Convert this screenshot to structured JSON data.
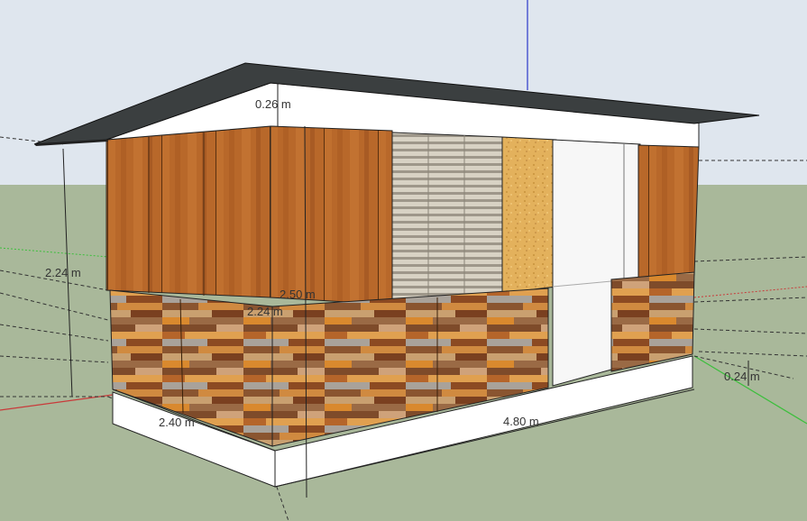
{
  "viewport": {
    "sky_color": "#dfe6ee",
    "ground_color": "#a9b89a",
    "axes": {
      "blue": "#2a37c9",
      "red": "#c93a3a",
      "green": "#3cbf3c"
    }
  },
  "model": {
    "roof_color": "#3b3f40",
    "wall_color": "#ffffff",
    "wood_panel_color": "#b86a2a",
    "blinds_color": "#c8c2b4",
    "particleboard_color": "#e0b05a",
    "door_color": "#f7f7f7"
  },
  "dimensions": {
    "roof_thickness": "0.26 m",
    "wall_height_left": "2.24 m",
    "wall_height_center": "2.50 m",
    "lower_panel_height": "2.24 m",
    "width": "2.40 m",
    "length": "4.80 m",
    "base_height": "0.24 m"
  }
}
